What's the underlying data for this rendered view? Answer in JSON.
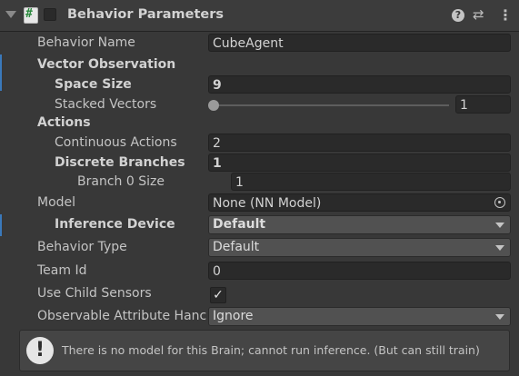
{
  "header": {
    "title": "Behavior Parameters",
    "script_glyph": "#",
    "help_glyph": "?",
    "preset_glyph": "⇄",
    "menu_glyph": "⋮"
  },
  "fields": {
    "behavior_name": {
      "label": "Behavior Name",
      "value": "CubeAgent"
    },
    "vector_observation": {
      "label": "Vector Observation"
    },
    "space_size": {
      "label": "Space Size",
      "value": "9"
    },
    "stacked_vectors": {
      "label": "Stacked Vectors",
      "value": "1",
      "slider_fraction": 0.0
    },
    "actions": {
      "label": "Actions"
    },
    "continuous_actions": {
      "label": "Continuous Actions",
      "value": "2"
    },
    "discrete_branches": {
      "label": "Discrete Branches",
      "value": "1"
    },
    "branch_0_size": {
      "label": "Branch 0 Size",
      "value": "1"
    },
    "model": {
      "label": "Model",
      "value": "None (NN Model)"
    },
    "inference_device": {
      "label": "Inference Device",
      "value": "Default"
    },
    "behavior_type": {
      "label": "Behavior Type",
      "value": "Default"
    },
    "team_id": {
      "label": "Team Id",
      "value": "0"
    },
    "use_child_sensors": {
      "label": "Use Child Sensors",
      "checked": true,
      "glyph": "✓"
    },
    "observable_attribute_handling": {
      "label": "Observable Attribute Hanc",
      "value": "Ignore"
    }
  },
  "helpbox": {
    "icon_glyph": "!",
    "text": "There is no model for this Brain; cannot run inference. (But can still train)"
  },
  "colors": {
    "panel_bg": "#383838",
    "field_bg": "#2a2a2a",
    "dropdown_bg": "#515151",
    "override_marker": "#3a79bb"
  }
}
